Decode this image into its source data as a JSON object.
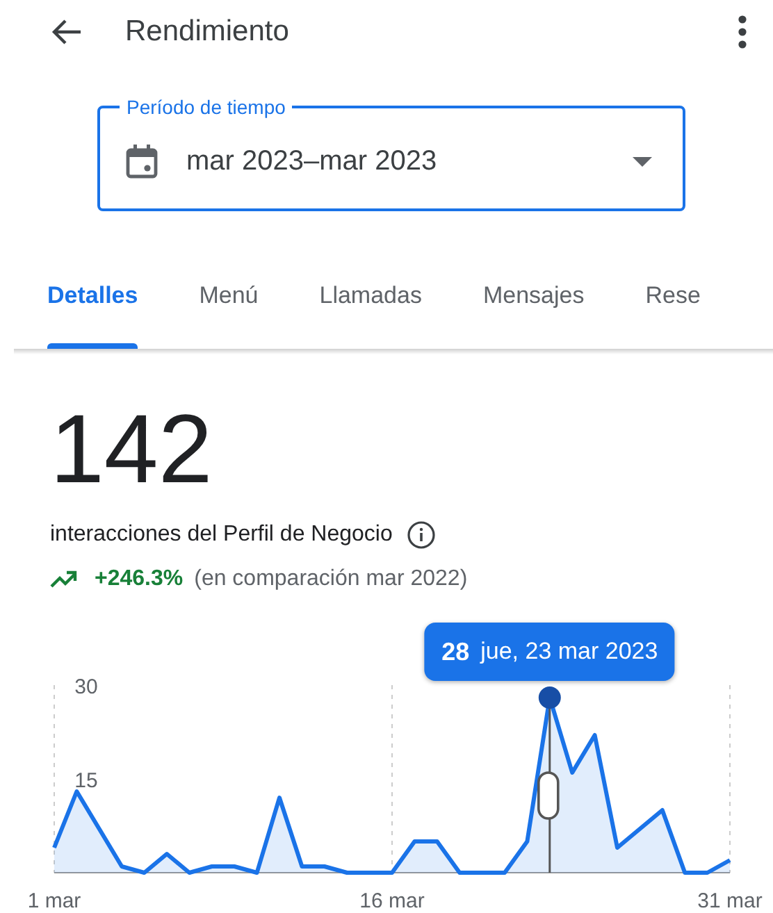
{
  "header": {
    "title": "Rendimiento"
  },
  "period_field": {
    "label": "Período de tiempo",
    "value": "mar 2023–mar 2023"
  },
  "tabs": [
    {
      "label": "Detalles",
      "selected": true
    },
    {
      "label": "Menú",
      "selected": false
    },
    {
      "label": "Llamadas",
      "selected": false
    },
    {
      "label": "Mensajes",
      "selected": false
    },
    {
      "label": "Rese",
      "selected": false
    }
  ],
  "summary": {
    "total": "142",
    "description": "interacciones del Perfil de Negocio",
    "trend": {
      "change": "+246.3%",
      "comparison": "(en comparación mar 2022)"
    }
  },
  "chart": {
    "tooltip": {
      "value": "28",
      "date": "jue, 23 mar 2023"
    },
    "chart_data": {
      "type": "area",
      "categories": [
        "1 mar",
        null,
        null,
        null,
        null,
        null,
        null,
        null,
        null,
        null,
        null,
        null,
        null,
        null,
        null,
        "16 mar",
        null,
        null,
        null,
        null,
        null,
        null,
        null,
        null,
        null,
        null,
        null,
        null,
        null,
        null,
        "31 mar"
      ],
      "series": [
        {
          "color": "#1a73e8",
          "values": [
            4,
            13,
            7,
            1,
            0,
            3,
            0,
            1,
            1,
            0,
            12,
            1,
            1,
            0,
            0,
            0,
            5,
            5,
            0,
            0,
            0,
            5,
            28,
            16,
            22,
            4,
            7,
            10,
            0,
            0,
            2
          ]
        }
      ],
      "ylim": [
        0,
        30
      ],
      "yticks": [
        {
          "value": 15,
          "label": "15"
        },
        {
          "value": 30,
          "label": "30"
        }
      ]
    }
  }
}
